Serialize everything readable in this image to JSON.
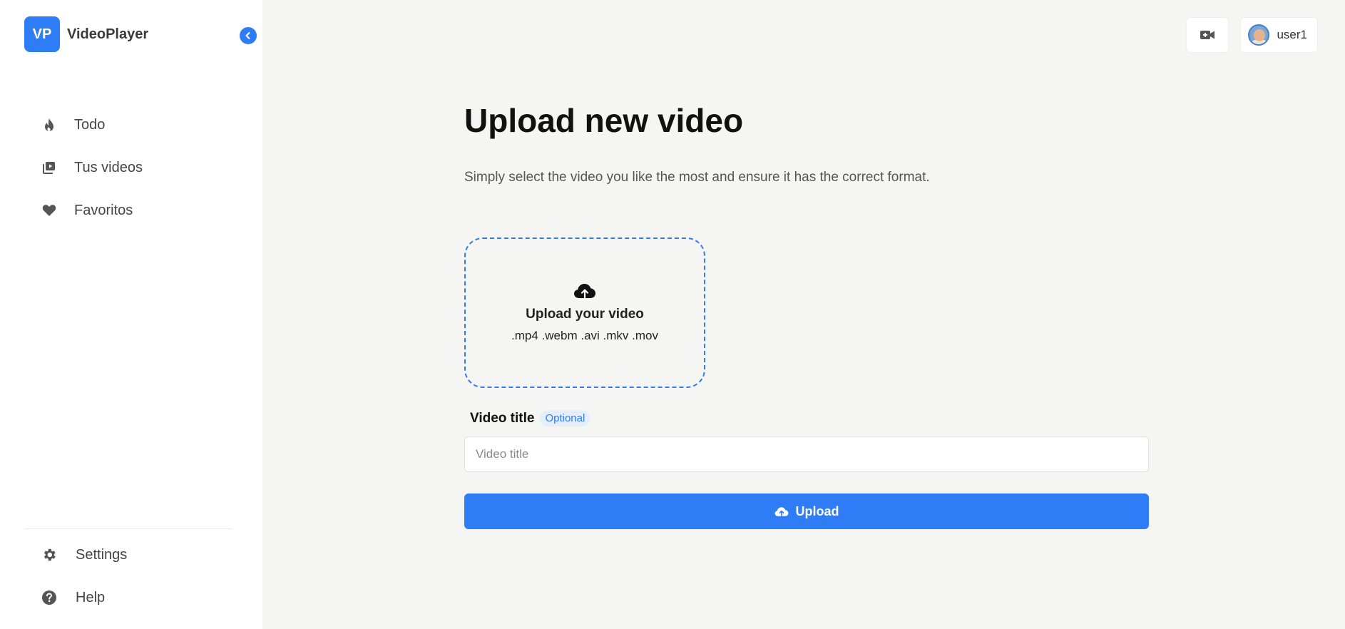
{
  "brand": {
    "logo_text": "VP",
    "name": "VideoPlayer"
  },
  "sidebar": {
    "items": [
      {
        "label": "Todo",
        "icon": "fire-icon"
      },
      {
        "label": "Tus videos",
        "icon": "video-library-icon"
      },
      {
        "label": "Favoritos",
        "icon": "heart-icon"
      }
    ],
    "bottom_items": [
      {
        "label": "Settings",
        "icon": "gear-icon"
      },
      {
        "label": "Help",
        "icon": "help-icon"
      }
    ],
    "collapse_icon": "chevron-left-icon"
  },
  "topbar": {
    "record_icon": "video-camera-plus-icon",
    "username": "user1"
  },
  "main": {
    "title": "Upload new video",
    "subtitle": "Simply select the video you like the most and ensure it has the correct format.",
    "dropzone": {
      "icon": "cloud-upload-icon",
      "title": "Upload your video",
      "formats": ".mp4 .webm .avi .mkv .mov"
    },
    "title_field": {
      "label": "Video title",
      "badge": "Optional",
      "placeholder": "Video title",
      "value": ""
    },
    "upload_button": {
      "label": "Upload",
      "icon": "cloud-upload-icon"
    }
  },
  "colors": {
    "accent": "#2e7cf6",
    "background": "#f5f5f4",
    "sidebar": "#ffffff"
  }
}
